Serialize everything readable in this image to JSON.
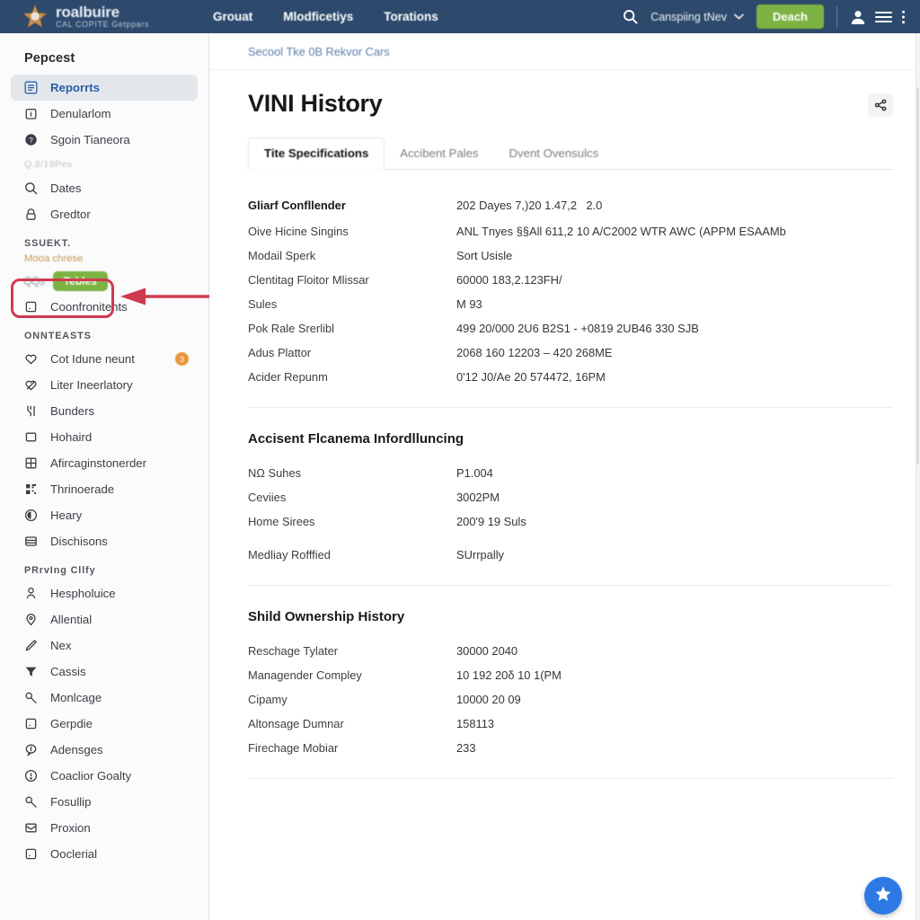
{
  "header": {
    "brand_title": "roalbuire",
    "brand_subtitle": "CAL COPITE Getppars",
    "logo_icon": "star-badge-icon",
    "nav": [
      {
        "label": "Grouat"
      },
      {
        "label": "Mlodficetiys"
      },
      {
        "label": "Torations"
      }
    ],
    "search_icon": "search-icon",
    "language": "Canspiing tNev",
    "chevron_icon": "chevron-down-icon",
    "cta_label": "Deach",
    "account_icon": "user-icon",
    "menu_icon": "hamburger-menu-icon",
    "more_icon": "kebab-menu-icon",
    "bar_color": "#2d4a6d",
    "cta_color": "#7cb342"
  },
  "sidebar": {
    "heading": "Pepcest",
    "caption_1": "Q.8/19Pes",
    "section_support": "SSUEKT.",
    "section_support_sub": "Mooa chrese",
    "section_contents": "ONNTEASTS",
    "section_privacy": "PRrvIng Cllfy",
    "pill_glyphs": "QQs",
    "pill_label": "Tebles",
    "groups": [
      {
        "items": [
          {
            "label": "Reporrts",
            "icon": "list-report-icon",
            "active": true
          },
          {
            "label": "Denularlom",
            "icon": "info-box-icon",
            "active": false
          },
          {
            "label": "Sgoin Tianeora",
            "icon": "help-circle-icon",
            "active": false
          }
        ]
      },
      {
        "items": [
          {
            "label": "Dates",
            "icon": "search-icon",
            "active": false
          },
          {
            "label": "Gredtor",
            "icon": "lock-icon",
            "active": false
          }
        ]
      },
      {
        "items": [
          {
            "label": "Coonfronitents",
            "icon": "square-dot-icon",
            "active": false
          }
        ]
      },
      {
        "items": [
          {
            "label": "Cot Idune neunt",
            "icon": "heart-icon",
            "badge": "3",
            "active": false
          },
          {
            "label": "Liter Ineerlatory",
            "icon": "heart-slash-icon",
            "active": false
          },
          {
            "label": "Bunders",
            "icon": "fork-icon",
            "active": false
          },
          {
            "label": "Hohaird",
            "icon": "square-icon",
            "active": false
          },
          {
            "label": "Afircaginstonerder",
            "icon": "grid-icon",
            "active": false
          },
          {
            "label": "Thrinoerade",
            "icon": "qr-code-icon",
            "active": false
          },
          {
            "label": "Heary",
            "icon": "circle-moon-icon",
            "active": false
          },
          {
            "label": "Dischisons",
            "icon": "card-lines-icon",
            "active": false
          }
        ]
      },
      {
        "items": [
          {
            "label": "Hespholuice",
            "icon": "person-icon",
            "active": false
          },
          {
            "label": "Allential",
            "icon": "map-pin-icon",
            "active": false
          },
          {
            "label": "Nex",
            "icon": "pencil-icon",
            "active": false
          },
          {
            "label": "Cassis",
            "icon": "funnel-icon",
            "active": false
          },
          {
            "label": "Monlcage",
            "icon": "key-icon",
            "active": false
          },
          {
            "label": "Gerpdie",
            "icon": "square-dot-icon",
            "active": false
          },
          {
            "label": "Adensges",
            "icon": "speech-bubble-icon",
            "active": false
          },
          {
            "label": "Coaclior Goalty",
            "icon": "alert-circle-icon",
            "active": false
          },
          {
            "label": "Fosullip",
            "icon": "key-icon",
            "active": false
          },
          {
            "label": "Proxion",
            "icon": "inbox-icon",
            "active": false
          },
          {
            "label": "Ooclerial",
            "icon": "square-dot-icon",
            "active": false
          }
        ]
      }
    ]
  },
  "annotation": {
    "highlight_color": "#cf3a50",
    "arrow_name": "red-pointer-arrow"
  },
  "main": {
    "breadcrumb": "Secool Tke 0B Rekvor Cars",
    "title": "VINI History",
    "share_icon": "share-icon",
    "tabs": [
      {
        "label": "Tite Specifications",
        "active": true
      },
      {
        "label": "Accibent Pales",
        "active": false
      },
      {
        "label": "Dvent Ovensulcs",
        "active": false
      }
    ],
    "sections": [
      {
        "title": null,
        "rows": [
          {
            "key": "Gliarf Confllender",
            "value": "202 Dayes 7,)20 1.47,22.0",
            "bold": true
          },
          {
            "key": "Oive Hicine Singins",
            "value": "ANL Tnyes §§All 611,2 10 A/C2002 WTR AWC (APPM ESAAMb"
          },
          {
            "key": "Modail Sperk",
            "value": "Sort Usisle"
          },
          {
            "key": "Clentitag Floitor Mlissar",
            "value": "60000 183,2.123FH/"
          },
          {
            "key": "Sules",
            "value": "M 93"
          },
          {
            "key": "Pok Rale Srerlibl",
            "value": "499 20/000 2U6 B2S1 - +0819 2UB46 330 SJB"
          },
          {
            "key": "Adus Plattor",
            "value": "2068 160 12203 – 420 268ME"
          },
          {
            "key": "Acider Repunm",
            "value": "0'12 J0/Ae 20 574472, 16PM"
          }
        ]
      },
      {
        "title": "Accisent Flcanema Infordlluncing",
        "rows": [
          {
            "key": "NΩ Suhes",
            "value": "P1.004"
          },
          {
            "key": "Ceviies",
            "value": "3002PM"
          },
          {
            "key": "Home Sirees",
            "value": "200'9 19 Suls"
          },
          {
            "key": "Medliay Rofffied",
            "value": "SUrrpally"
          }
        ]
      },
      {
        "title": "Shild Ownership History",
        "rows": [
          {
            "key": "Reschage Tylater",
            "value": "30000 2040"
          },
          {
            "key": "Managender Compley",
            "value": "10 192 20δ 10 1(PM"
          },
          {
            "key": "Cipamy",
            "value": "10000 20 09"
          },
          {
            "key": "Altonsage Dumnar",
            "value": "158113"
          },
          {
            "key": "Firechage Mobiar",
            "value": "233"
          }
        ]
      }
    ],
    "fab_icon": "star-icon",
    "fab_color": "#2d7ae5"
  }
}
